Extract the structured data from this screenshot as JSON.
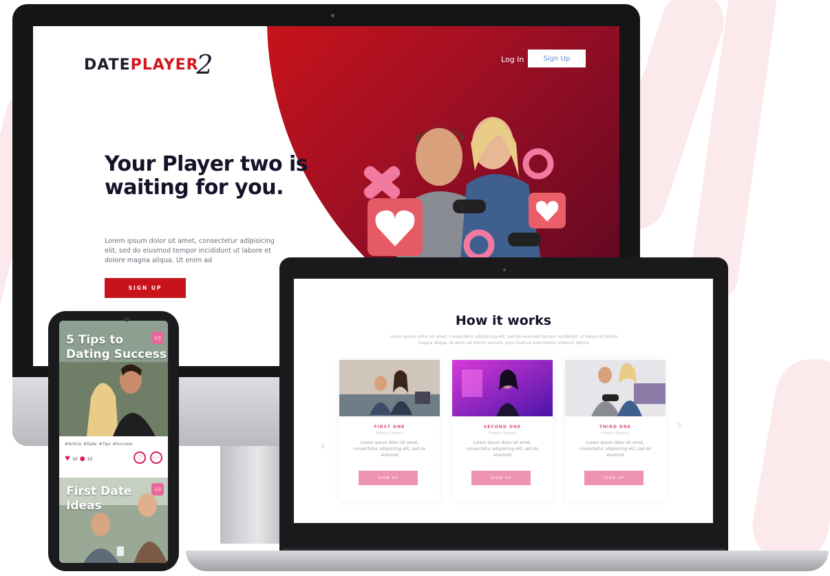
{
  "colors": {
    "brand_red": "#c8131b",
    "dark_navy": "#13132a",
    "pink_button": "#ef93b4",
    "pink_accent": "#d24e82"
  },
  "desktop": {
    "logo": {
      "part1": "DATE",
      "part2": "PLAYER",
      "part3": "2"
    },
    "nav": {
      "login": "Log In",
      "signup": "Sign Up"
    },
    "hero": {
      "headline": "Your Player two is waiting for you.",
      "paragraph": "Lorem ipsum dolor sit amet, consectetur adipisicing elit, sed do eiusmod tempor incididunt ut labore et dolore magna aliqua. Ut enim ad",
      "cta": "SIGN UP"
    }
  },
  "laptop": {
    "title": "How it works",
    "subtitle": "Lorem ipsum dolor sit amet, consectetur adipisicing elit, sed do eiusmod tempor incididunt ut labore et dolore magna aliqua. Ut enim ad minim veniam, quis nostrud exercitation ullamco laboris",
    "cards": [
      {
        "title": "FIRST ONE",
        "subtitle": "Project Details",
        "text": "Lorem ipsum dolor sit amet, consectetur adipisicing elit, sed do eiusmod",
        "button": "SIGN UP"
      },
      {
        "title": "SECOND ONE",
        "subtitle": "Project Details",
        "text": "Lorem ipsum dolor sit amet, consectetur adipisicing elit, sed do eiusmod",
        "button": "SIGN UP"
      },
      {
        "title": "THIRD ONE",
        "subtitle": "Project Details",
        "text": "Lorem ipsum dolor sit amet, consectetur adipisicing elit, sed do eiusmod",
        "button": "SIGN UP"
      }
    ],
    "prev_icon": "chevron-left-icon",
    "next_icon": "chevron-right-icon"
  },
  "phone": {
    "post1": {
      "title": "5 Tips to Dating Success",
      "badge": "1/3",
      "tags": "#Article #Date #Tips #Success",
      "likes": "10",
      "comments": "10"
    },
    "post2": {
      "title": "First Date Ideas",
      "badge": "1/3"
    }
  }
}
